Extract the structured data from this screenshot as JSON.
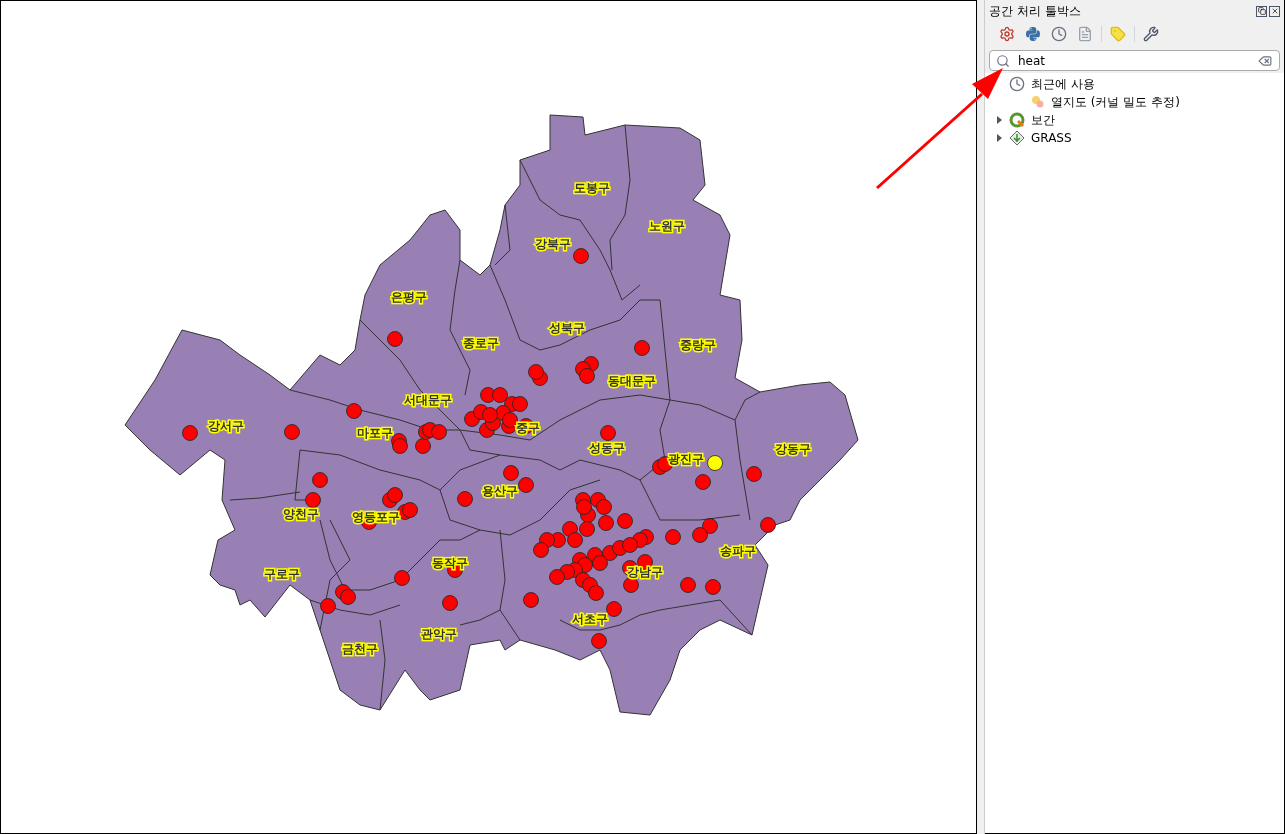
{
  "map": {
    "district_labels": [
      "도봉구",
      "노원구",
      "강북구",
      "은평구",
      "성북구",
      "종로구",
      "중랑구",
      "동대문구",
      "서대문구",
      "강서구",
      "마포구",
      "중구",
      "성동구",
      "광진구",
      "강동구",
      "용산구",
      "양천구",
      "영등포구",
      "송파구",
      "구로구",
      "동작구",
      "강남구",
      "관악구",
      "서초구",
      "금천구"
    ]
  },
  "panel": {
    "title": "공간 처리 툴박스",
    "search": {
      "value": "heat"
    },
    "tree": [
      {
        "label": "최근에 사용",
        "kind": "recent",
        "expanded": true,
        "children": [
          {
            "label": "열지도 (커널 밀도 추정)",
            "kind": "heatmap"
          }
        ]
      },
      {
        "label": "보간",
        "kind": "qgis",
        "expanded": false
      },
      {
        "label": "GRASS",
        "kind": "grass",
        "expanded": false
      }
    ]
  }
}
